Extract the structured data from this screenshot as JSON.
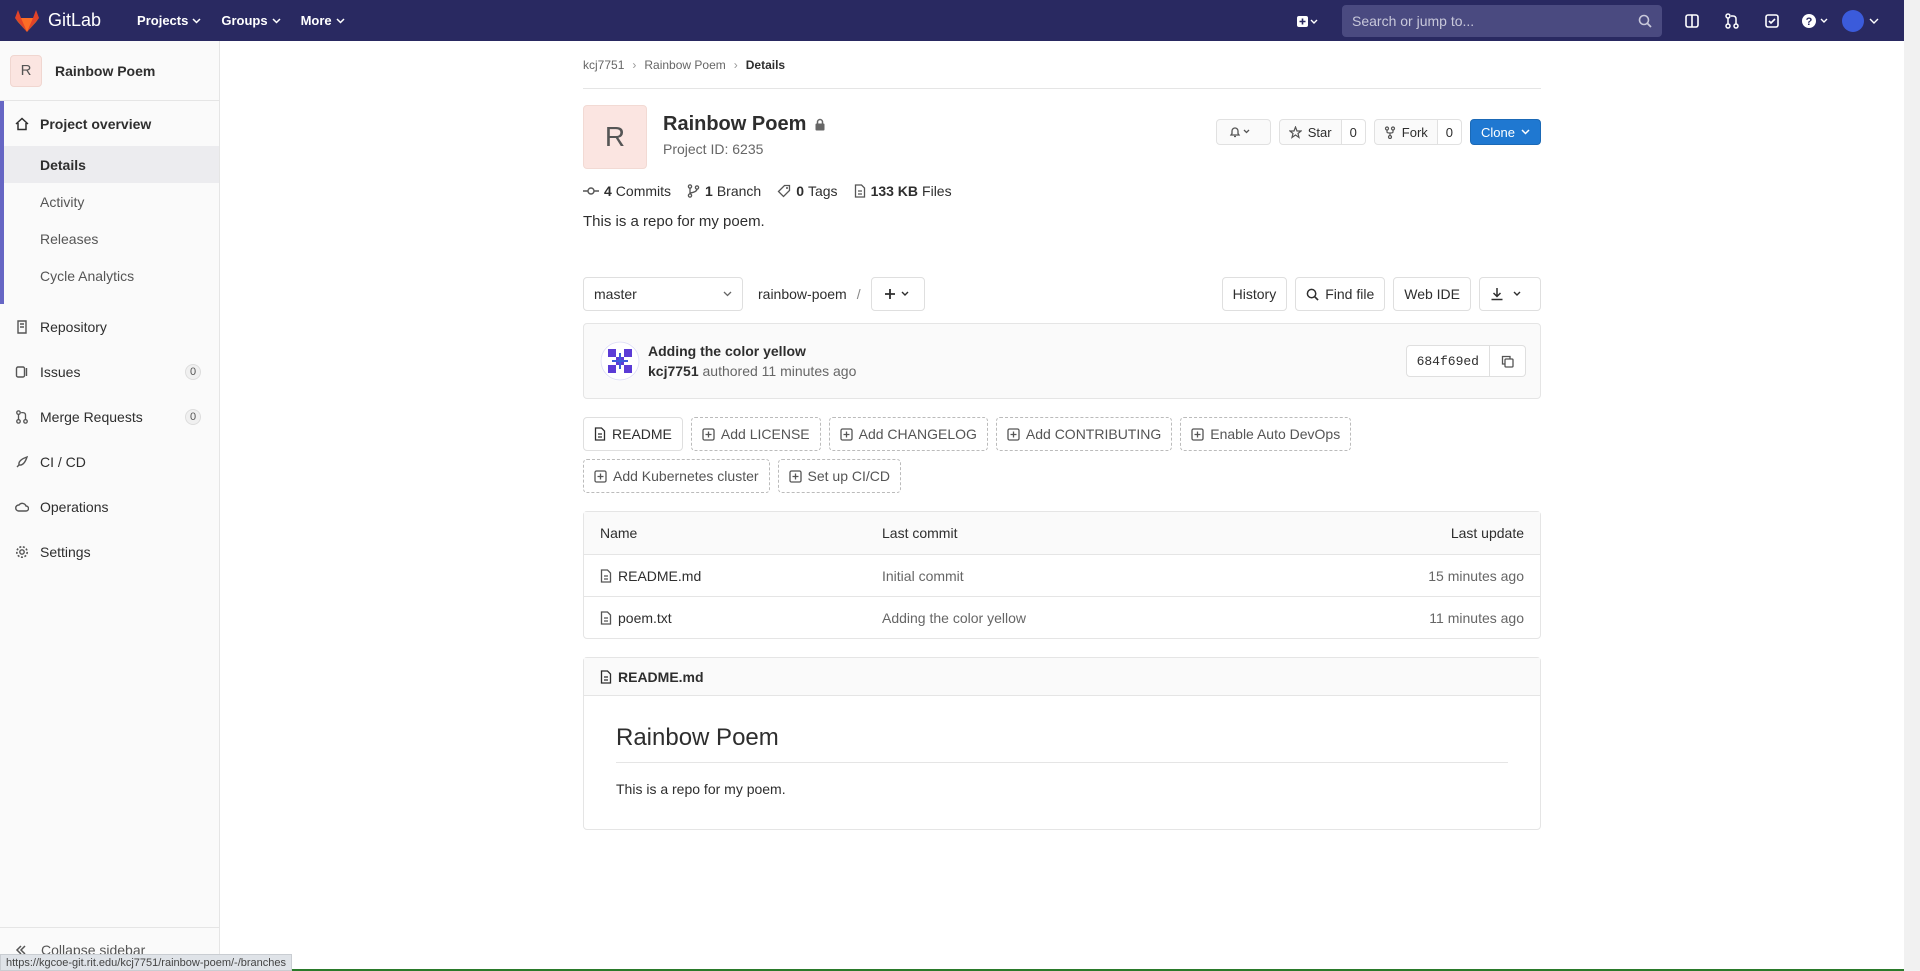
{
  "topnav": {
    "brand": "GitLab",
    "menu": [
      "Projects",
      "Groups",
      "More"
    ],
    "search_placeholder": "Search or jump to..."
  },
  "sidebar": {
    "project_initial": "R",
    "project_name": "Rainbow Poem",
    "overview": {
      "label": "Project overview",
      "subitems": [
        "Details",
        "Activity",
        "Releases",
        "Cycle Analytics"
      ]
    },
    "items": [
      {
        "label": "Repository"
      },
      {
        "label": "Issues",
        "count": "0"
      },
      {
        "label": "Merge Requests",
        "count": "0"
      },
      {
        "label": "CI / CD"
      },
      {
        "label": "Operations"
      },
      {
        "label": "Settings"
      }
    ],
    "collapse_label": "Collapse sidebar"
  },
  "breadcrumb": [
    "kcj7751",
    "Rainbow Poem",
    "Details"
  ],
  "project": {
    "initial": "R",
    "title": "Rainbow Poem",
    "id_text": "Project ID: 6235",
    "star_label": "Star",
    "star_count": "0",
    "fork_label": "Fork",
    "fork_count": "0",
    "clone_label": "Clone",
    "stats": [
      {
        "num": "4",
        "label": "Commits"
      },
      {
        "num": "1",
        "label": "Branch"
      },
      {
        "num": "0",
        "label": "Tags"
      },
      {
        "num": "133 KB",
        "label": "Files"
      }
    ],
    "description": "This is a repo for my poem."
  },
  "tree": {
    "branch": "master",
    "path": "rainbow-poem",
    "path_sep": "/",
    "buttons": [
      "History",
      "Find file",
      "Web IDE"
    ]
  },
  "commit": {
    "title": "Adding the color yellow",
    "author": "kcj7751",
    "meta": "authored 11 minutes ago",
    "sha": "684f69ed"
  },
  "add_links": [
    "README",
    "Add LICENSE",
    "Add CHANGELOG",
    "Add CONTRIBUTING",
    "Enable Auto DevOps",
    "Add Kubernetes cluster",
    "Set up CI/CD"
  ],
  "files": {
    "headers": [
      "Name",
      "Last commit",
      "Last update"
    ],
    "rows": [
      {
        "name": "README.md",
        "commit": "Initial commit",
        "updated": "15 minutes ago"
      },
      {
        "name": "poem.txt",
        "commit": "Adding the color yellow",
        "updated": "11 minutes ago"
      }
    ]
  },
  "readme": {
    "filename": "README.md",
    "heading": "Rainbow Poem",
    "body": "This is a repo for my poem."
  },
  "status_url": "https://kgcoe-git.rit.edu/kcj7751/rainbow-poem/-/branches",
  "colors": {
    "nav": "#292961",
    "accent": "#6666c4",
    "primary": "#1f78d1",
    "logo": "#e24329"
  }
}
